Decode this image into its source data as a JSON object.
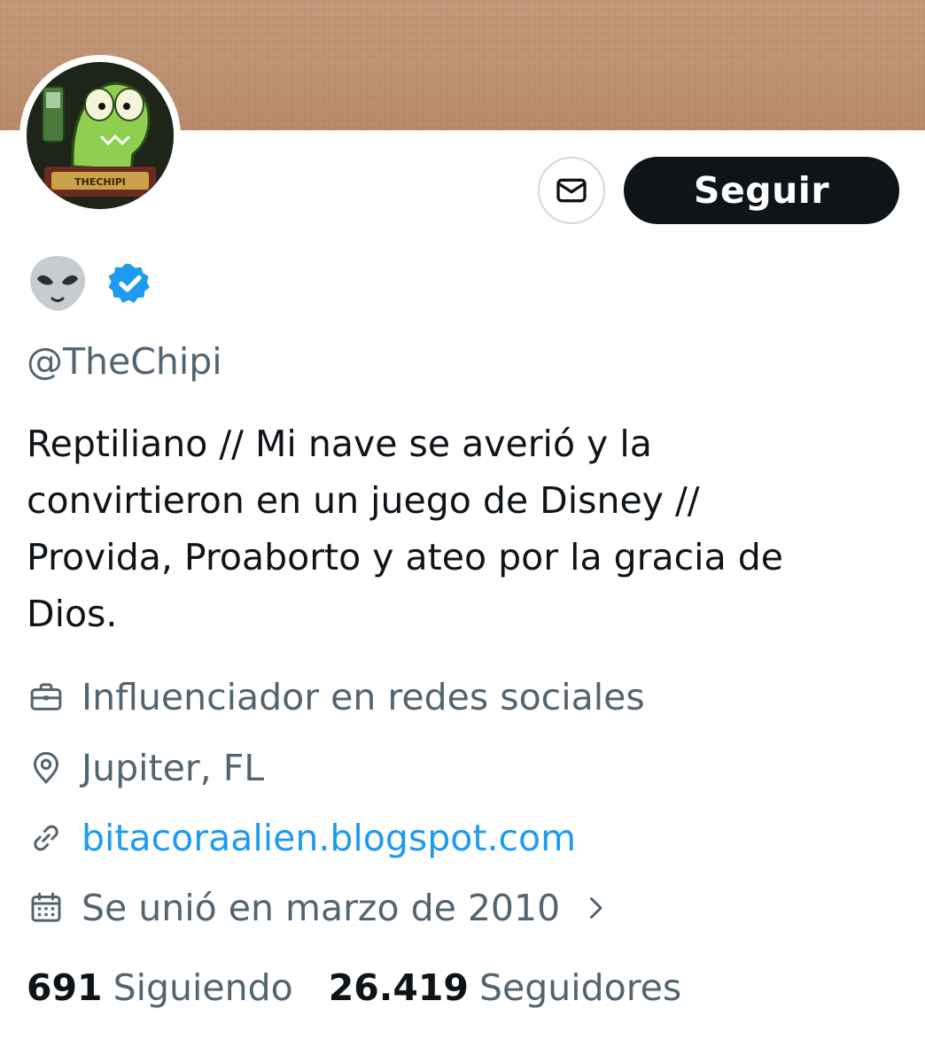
{
  "profile": {
    "name_emoji": "alien-emoji",
    "verified_icon": "verified-badge-icon",
    "handle": "@TheChipi",
    "avatar_label": "THECHIPI",
    "bio_lines": [
      "Reptiliano // Mi nave se averió y la",
      "convirtieron en un juego de Disney //",
      "Provida, Proaborto y ateo por la gracia de",
      "Dios."
    ]
  },
  "actions": {
    "message_icon": "envelope-icon",
    "follow_label": "Seguir"
  },
  "meta": {
    "category": "Influenciador en redes sociales",
    "location": "Jupiter, FL",
    "website": "bitacoraalien.blogspot.com",
    "joined": "Se unió en marzo de 2010"
  },
  "stats": {
    "following_count": "691",
    "following_label": "Siguiendo",
    "followers_count": "26.419",
    "followers_label": "Seguidores"
  },
  "colors": {
    "text_primary": "#0f1419",
    "text_secondary": "#536471",
    "link": "#1d9bf0",
    "verified": "#1d9bf0",
    "follow_button_bg": "#0f1419"
  }
}
